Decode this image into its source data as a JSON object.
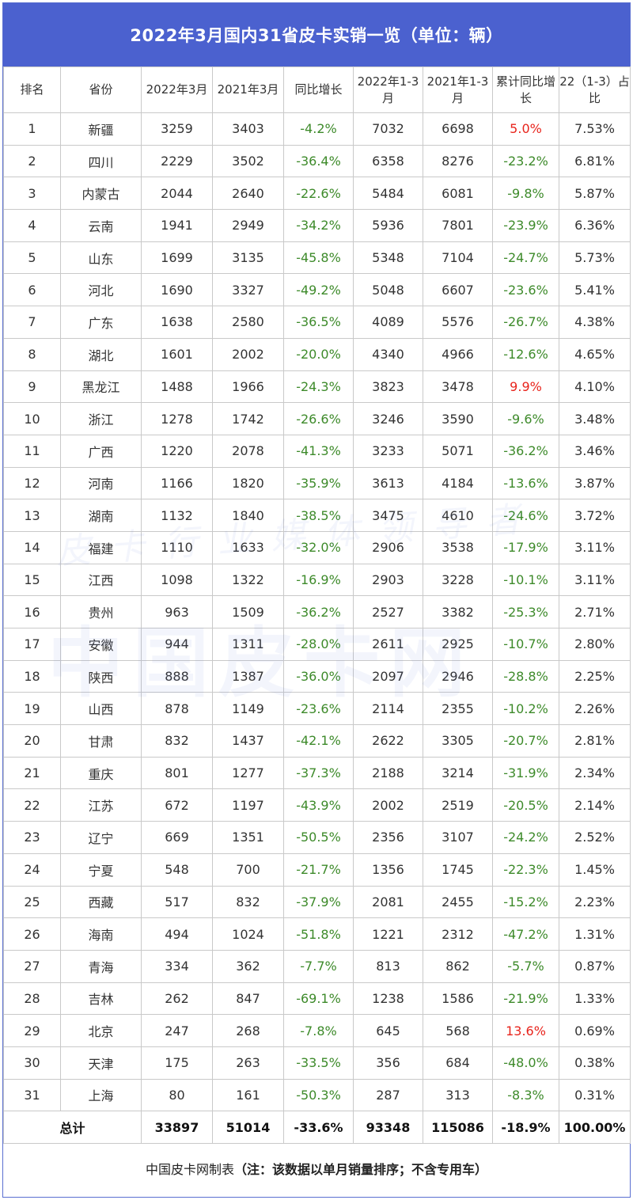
{
  "title": "2022年3月国内31省皮卡实销一览（单位：辆）",
  "headers": [
    "排名",
    "省份",
    "2022年3月",
    "2021年3月",
    "同比增长",
    "2022年1-3月",
    "2021年1-3月",
    "累计同比增长",
    "22（1-3）占比"
  ],
  "rows": [
    {
      "rank": "1",
      "province": "新疆",
      "m2022": "3259",
      "m2021": "3403",
      "yoy": "-4.2%",
      "q2022": "7032",
      "q2021": "6698",
      "cum_yoy": "5.0%",
      "share": "7.53%"
    },
    {
      "rank": "2",
      "province": "四川",
      "m2022": "2229",
      "m2021": "3502",
      "yoy": "-36.4%",
      "q2022": "6358",
      "q2021": "8276",
      "cum_yoy": "-23.2%",
      "share": "6.81%"
    },
    {
      "rank": "3",
      "province": "内蒙古",
      "m2022": "2044",
      "m2021": "2640",
      "yoy": "-22.6%",
      "q2022": "5484",
      "q2021": "6081",
      "cum_yoy": "-9.8%",
      "share": "5.87%"
    },
    {
      "rank": "4",
      "province": "云南",
      "m2022": "1941",
      "m2021": "2949",
      "yoy": "-34.2%",
      "q2022": "5936",
      "q2021": "7801",
      "cum_yoy": "-23.9%",
      "share": "6.36%"
    },
    {
      "rank": "5",
      "province": "山东",
      "m2022": "1699",
      "m2021": "3135",
      "yoy": "-45.8%",
      "q2022": "5348",
      "q2021": "7104",
      "cum_yoy": "-24.7%",
      "share": "5.73%"
    },
    {
      "rank": "6",
      "province": "河北",
      "m2022": "1690",
      "m2021": "3327",
      "yoy": "-49.2%",
      "q2022": "5048",
      "q2021": "6607",
      "cum_yoy": "-23.6%",
      "share": "5.41%"
    },
    {
      "rank": "7",
      "province": "广东",
      "m2022": "1638",
      "m2021": "2580",
      "yoy": "-36.5%",
      "q2022": "4089",
      "q2021": "5576",
      "cum_yoy": "-26.7%",
      "share": "4.38%"
    },
    {
      "rank": "8",
      "province": "湖北",
      "m2022": "1601",
      "m2021": "2002",
      "yoy": "-20.0%",
      "q2022": "4340",
      "q2021": "4966",
      "cum_yoy": "-12.6%",
      "share": "4.65%"
    },
    {
      "rank": "9",
      "province": "黑龙江",
      "m2022": "1488",
      "m2021": "1966",
      "yoy": "-24.3%",
      "q2022": "3823",
      "q2021": "3478",
      "cum_yoy": "9.9%",
      "share": "4.10%"
    },
    {
      "rank": "10",
      "province": "浙江",
      "m2022": "1278",
      "m2021": "1742",
      "yoy": "-26.6%",
      "q2022": "3246",
      "q2021": "3590",
      "cum_yoy": "-9.6%",
      "share": "3.48%"
    },
    {
      "rank": "11",
      "province": "广西",
      "m2022": "1220",
      "m2021": "2078",
      "yoy": "-41.3%",
      "q2022": "3233",
      "q2021": "5071",
      "cum_yoy": "-36.2%",
      "share": "3.46%"
    },
    {
      "rank": "12",
      "province": "河南",
      "m2022": "1166",
      "m2021": "1820",
      "yoy": "-35.9%",
      "q2022": "3613",
      "q2021": "4184",
      "cum_yoy": "-13.6%",
      "share": "3.87%"
    },
    {
      "rank": "13",
      "province": "湖南",
      "m2022": "1132",
      "m2021": "1840",
      "yoy": "-38.5%",
      "q2022": "3475",
      "q2021": "4610",
      "cum_yoy": "-24.6%",
      "share": "3.72%"
    },
    {
      "rank": "14",
      "province": "福建",
      "m2022": "1110",
      "m2021": "1633",
      "yoy": "-32.0%",
      "q2022": "2906",
      "q2021": "3538",
      "cum_yoy": "-17.9%",
      "share": "3.11%"
    },
    {
      "rank": "15",
      "province": "江西",
      "m2022": "1098",
      "m2021": "1322",
      "yoy": "-16.9%",
      "q2022": "2903",
      "q2021": "3228",
      "cum_yoy": "-10.1%",
      "share": "3.11%"
    },
    {
      "rank": "16",
      "province": "贵州",
      "m2022": "963",
      "m2021": "1509",
      "yoy": "-36.2%",
      "q2022": "2527",
      "q2021": "3382",
      "cum_yoy": "-25.3%",
      "share": "2.71%"
    },
    {
      "rank": "17",
      "province": "安徽",
      "m2022": "944",
      "m2021": "1311",
      "yoy": "-28.0%",
      "q2022": "2611",
      "q2021": "2925",
      "cum_yoy": "-10.7%",
      "share": "2.80%"
    },
    {
      "rank": "18",
      "province": "陕西",
      "m2022": "888",
      "m2021": "1387",
      "yoy": "-36.0%",
      "q2022": "2097",
      "q2021": "2946",
      "cum_yoy": "-28.8%",
      "share": "2.25%"
    },
    {
      "rank": "19",
      "province": "山西",
      "m2022": "878",
      "m2021": "1149",
      "yoy": "-23.6%",
      "q2022": "2114",
      "q2021": "2355",
      "cum_yoy": "-10.2%",
      "share": "2.26%"
    },
    {
      "rank": "20",
      "province": "甘肃",
      "m2022": "832",
      "m2021": "1437",
      "yoy": "-42.1%",
      "q2022": "2622",
      "q2021": "3305",
      "cum_yoy": "-20.7%",
      "share": "2.81%"
    },
    {
      "rank": "21",
      "province": "重庆",
      "m2022": "801",
      "m2021": "1277",
      "yoy": "-37.3%",
      "q2022": "2188",
      "q2021": "3214",
      "cum_yoy": "-31.9%",
      "share": "2.34%"
    },
    {
      "rank": "22",
      "province": "江苏",
      "m2022": "672",
      "m2021": "1197",
      "yoy": "-43.9%",
      "q2022": "2002",
      "q2021": "2519",
      "cum_yoy": "-20.5%",
      "share": "2.14%"
    },
    {
      "rank": "23",
      "province": "辽宁",
      "m2022": "669",
      "m2021": "1351",
      "yoy": "-50.5%",
      "q2022": "2356",
      "q2021": "3107",
      "cum_yoy": "-24.2%",
      "share": "2.52%"
    },
    {
      "rank": "24",
      "province": "宁夏",
      "m2022": "548",
      "m2021": "700",
      "yoy": "-21.7%",
      "q2022": "1356",
      "q2021": "1745",
      "cum_yoy": "-22.3%",
      "share": "1.45%"
    },
    {
      "rank": "25",
      "province": "西藏",
      "m2022": "517",
      "m2021": "832",
      "yoy": "-37.9%",
      "q2022": "2081",
      "q2021": "2455",
      "cum_yoy": "-15.2%",
      "share": "2.23%"
    },
    {
      "rank": "26",
      "province": "海南",
      "m2022": "494",
      "m2021": "1024",
      "yoy": "-51.8%",
      "q2022": "1221",
      "q2021": "2312",
      "cum_yoy": "-47.2%",
      "share": "1.31%"
    },
    {
      "rank": "27",
      "province": "青海",
      "m2022": "334",
      "m2021": "362",
      "yoy": "-7.7%",
      "q2022": "813",
      "q2021": "862",
      "cum_yoy": "-5.7%",
      "share": "0.87%"
    },
    {
      "rank": "28",
      "province": "吉林",
      "m2022": "262",
      "m2021": "847",
      "yoy": "-69.1%",
      "q2022": "1238",
      "q2021": "1586",
      "cum_yoy": "-21.9%",
      "share": "1.33%"
    },
    {
      "rank": "29",
      "province": "北京",
      "m2022": "247",
      "m2021": "268",
      "yoy": "-7.8%",
      "q2022": "645",
      "q2021": "568",
      "cum_yoy": "13.6%",
      "share": "0.69%"
    },
    {
      "rank": "30",
      "province": "天津",
      "m2022": "175",
      "m2021": "263",
      "yoy": "-33.5%",
      "q2022": "356",
      "q2021": "684",
      "cum_yoy": "-48.0%",
      "share": "0.38%"
    },
    {
      "rank": "31",
      "province": "上海",
      "m2022": "80",
      "m2021": "161",
      "yoy": "-50.3%",
      "q2022": "287",
      "q2021": "313",
      "cum_yoy": "-8.3%",
      "share": "0.31%"
    }
  ],
  "total": {
    "label": "总计",
    "m2022": "33897",
    "m2021": "51014",
    "yoy": "-33.6%",
    "q2022": "93348",
    "q2021": "115086",
    "cum_yoy": "-18.9%",
    "share": "100.00%"
  },
  "footer": {
    "source": "中国皮卡网制表",
    "note": "（注：该数据以单月销量排序；不含专用车）"
  },
  "watermark": {
    "main": "中国皮卡网",
    "sub": "皮卡行业媒体领导者"
  },
  "colors": {
    "header_bg": "#4b61cf",
    "negative": "#3d8a2a",
    "positive": "#e8241c"
  }
}
